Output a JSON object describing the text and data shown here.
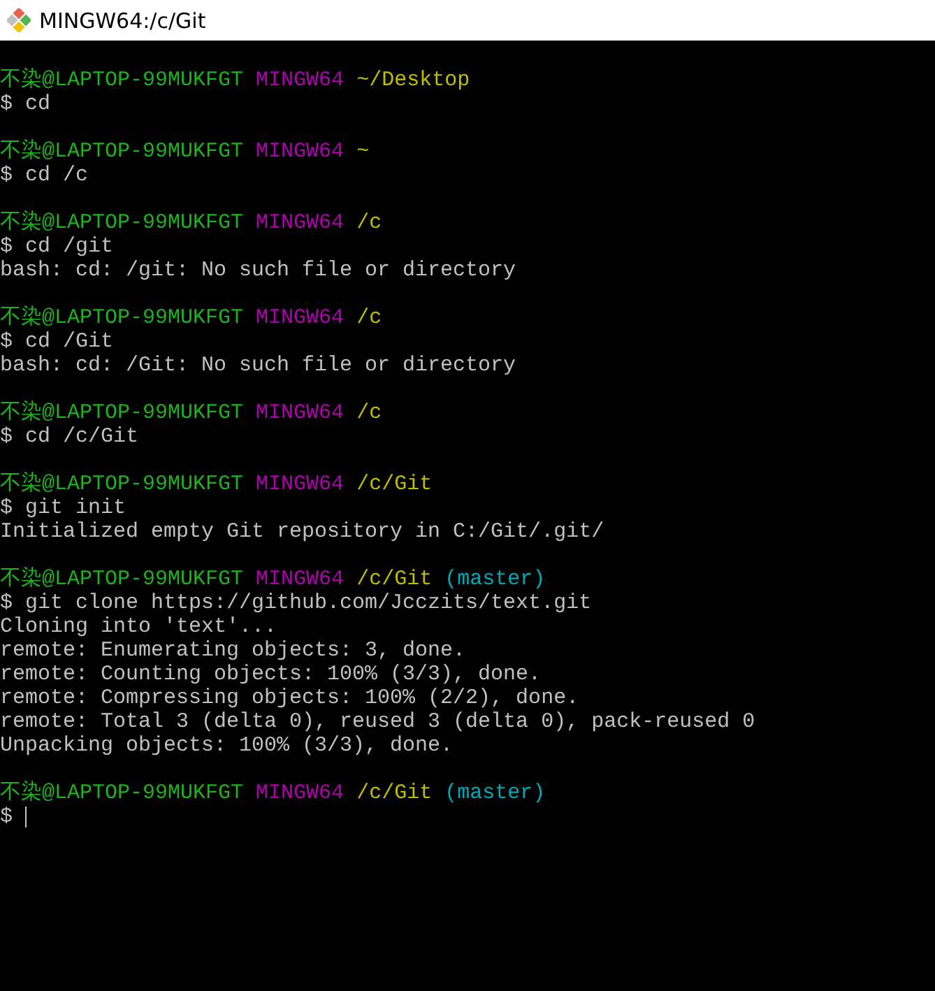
{
  "window": {
    "title": "MINGW64:/c/Git"
  },
  "blocks": [
    {
      "prompt": {
        "user": "不染@LAPTOP-99MUKFGT",
        "shell": "MINGW64",
        "path": "~/Desktop"
      },
      "lines": [
        {
          "kind": "command",
          "text": "$ cd"
        }
      ]
    },
    {
      "prompt": {
        "user": "不染@LAPTOP-99MUKFGT",
        "shell": "MINGW64",
        "path": "~"
      },
      "lines": [
        {
          "kind": "command",
          "text": "$ cd /c"
        }
      ]
    },
    {
      "prompt": {
        "user": "不染@LAPTOP-99MUKFGT",
        "shell": "MINGW64",
        "path": "/c"
      },
      "lines": [
        {
          "kind": "command",
          "text": "$ cd /git"
        },
        {
          "kind": "output",
          "text": "bash: cd: /git: No such file or directory"
        }
      ]
    },
    {
      "prompt": {
        "user": "不染@LAPTOP-99MUKFGT",
        "shell": "MINGW64",
        "path": "/c"
      },
      "lines": [
        {
          "kind": "command",
          "text": "$ cd /Git"
        },
        {
          "kind": "output",
          "text": "bash: cd: /Git: No such file or directory"
        }
      ]
    },
    {
      "prompt": {
        "user": "不染@LAPTOP-99MUKFGT",
        "shell": "MINGW64",
        "path": "/c"
      },
      "lines": [
        {
          "kind": "command",
          "text": "$ cd /c/Git"
        }
      ]
    },
    {
      "prompt": {
        "user": "不染@LAPTOP-99MUKFGT",
        "shell": "MINGW64",
        "path": "/c/Git"
      },
      "lines": [
        {
          "kind": "command",
          "text": "$ git init"
        },
        {
          "kind": "output",
          "text": "Initialized empty Git repository in C:/Git/.git/"
        }
      ]
    },
    {
      "prompt": {
        "user": "不染@LAPTOP-99MUKFGT",
        "shell": "MINGW64",
        "path": "/c/Git",
        "branch": "(master)"
      },
      "lines": [
        {
          "kind": "command",
          "text": "$ git clone https://github.com/Jcczits/text.git"
        },
        {
          "kind": "output",
          "text": "Cloning into 'text'..."
        },
        {
          "kind": "output",
          "text": "remote: Enumerating objects: 3, done."
        },
        {
          "kind": "output",
          "text": "remote: Counting objects: 100% (3/3), done."
        },
        {
          "kind": "output",
          "text": "remote: Compressing objects: 100% (2/2), done."
        },
        {
          "kind": "output",
          "text": "remote: Total 3 (delta 0), reused 3 (delta 0), pack-reused 0"
        },
        {
          "kind": "output",
          "text": "Unpacking objects: 100% (3/3), done."
        }
      ]
    },
    {
      "prompt": {
        "user": "不染@LAPTOP-99MUKFGT",
        "shell": "MINGW64",
        "path": "/c/Git",
        "branch": "(master)"
      },
      "lines": [
        {
          "kind": "input",
          "text": "$"
        }
      ]
    }
  ]
}
